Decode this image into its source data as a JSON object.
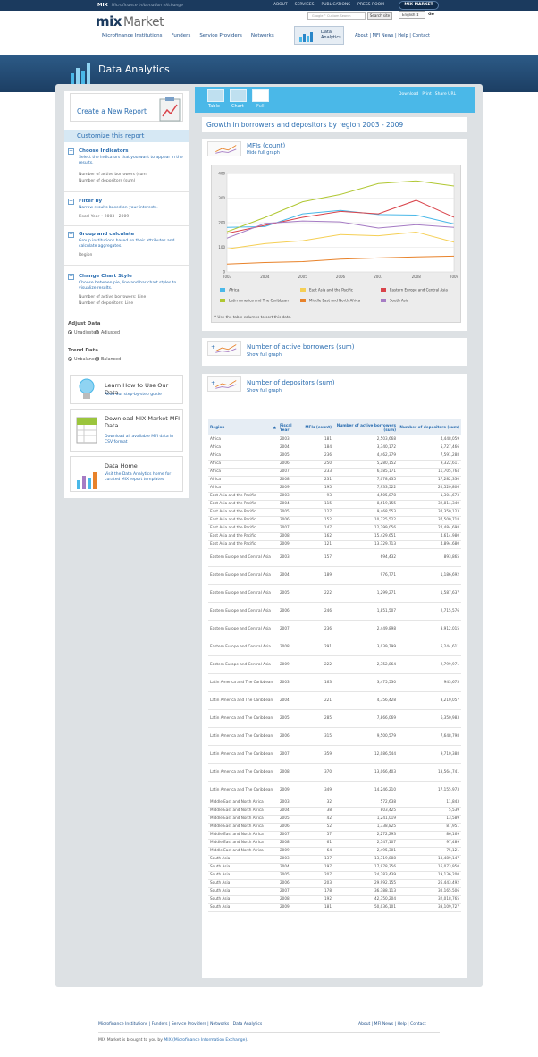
{
  "topbar": {
    "brand": "MIX",
    "tagline": "Microfinance Information eXchange",
    "links": [
      "ABOUT",
      "SERVICES",
      "PUBLICATIONS",
      "PRESS ROOM"
    ],
    "mix_market_btn": "MIX MARKET"
  },
  "header": {
    "logo_mark": "mix",
    "logo_word": "Market",
    "search_placeholder": "Google™ Custom Search",
    "search_btn": "Search site",
    "lang": "English",
    "go": "Go"
  },
  "mainnav": [
    "Microfinance Institutions",
    "Funders",
    "Service Providers",
    "Networks"
  ],
  "data_tab": {
    "line1": "Data",
    "line2": "Analytics"
  },
  "secnav": "About  |  MFI News  |  Help  |  Contact",
  "banner": {
    "title": "Data Analytics"
  },
  "left": {
    "create": "Create a New Report",
    "customize": "Customize this report",
    "indicators": {
      "h": "Choose Indicators",
      "d": "Select the indicators that you want to appear in the results.",
      "v1": "Number of active borrowers (sum)",
      "v2": "Number of depositors (sum)"
    },
    "filter": {
      "h": "Filter by",
      "d": "Narrow results based on your interests.",
      "v1": "Fiscal Year • 2003 - 2009"
    },
    "group": {
      "h": "Group and calculate",
      "d": "Group institutions based on their attributes and calculate aggregates.",
      "v1": "Region"
    },
    "style": {
      "h": "Change Chart Style",
      "d": "Choose between pie, line and bar chart styles to visualize results.",
      "v1": "Number of active borrowers: Line",
      "v2": "Number of depositors: Line"
    },
    "adjust": {
      "h": "Adjust Data",
      "o1": "Unadjusted",
      "o2": "Adjusted"
    },
    "trend": {
      "h": "Trend Data",
      "o1": "Unbalanced",
      "o2": "Balanced"
    },
    "card1": {
      "t": "Learn How to Use Our Data",
      "s": "Read our step-by-step guide"
    },
    "card2": {
      "t": "Download MIX Market MFI Data",
      "s": "Download all available MFI data in CSV format"
    },
    "card3": {
      "t": "Data Home",
      "s": "Visit the Data Analytics home for curated MIX report templates"
    }
  },
  "tabs": {
    "table": "Table",
    "chart": "Chart",
    "full": "Full"
  },
  "toplinks": [
    "Download",
    "Print",
    "Share URL"
  ],
  "report_title": "Growth in borrowers and depositors by region 2003 - 2009",
  "ind1": {
    "t": "MFIs (count)",
    "s": "Hide full graph"
  },
  "ind2": {
    "t": "Number of active borrowers (sum)",
    "s": "Show full graph"
  },
  "ind3": {
    "t": "Number of depositors (sum)",
    "s": "Show full graph"
  },
  "chart_note": "* Use the table columns to sort this data.",
  "chart_data": {
    "type": "line",
    "title": "MFIs (count)",
    "x": [
      2003,
      2004,
      2005,
      2006,
      2007,
      2008,
      2009
    ],
    "ylim": [
      0,
      400
    ],
    "yticks": [
      0,
      100,
      200,
      300,
      400
    ],
    "series": [
      {
        "name": "Africa",
        "color": "#4ab8e8",
        "values": [
          181,
          184,
          236,
          250,
          233,
          231,
          195
        ]
      },
      {
        "name": "East Asia and the Pacific",
        "color": "#f5cf55",
        "values": [
          93,
          115,
          127,
          152,
          147,
          162,
          121
        ]
      },
      {
        "name": "Eastern Europe and Central Asia",
        "color": "#d9434a",
        "values": [
          157,
          189,
          222,
          246,
          236,
          291,
          222
        ]
      },
      {
        "name": "Latin America and The Caribbean",
        "color": "#b0c732",
        "values": [
          163,
          221,
          285,
          315,
          359,
          370,
          349
        ]
      },
      {
        "name": "Middle East and North Africa",
        "color": "#e8822a",
        "values": [
          32,
          38,
          42,
          52,
          57,
          61,
          64
        ]
      },
      {
        "name": "South Asia",
        "color": "#a67cc4",
        "values": [
          137,
          197,
          207,
          203,
          178,
          192,
          181
        ]
      }
    ],
    "grid": true,
    "legend": "bottom"
  },
  "table": {
    "headers": [
      "Region",
      "Fiscal Year",
      "MFIs (count)",
      "Number of active borrowers (sum)",
      "Number of depositors (sum)"
    ],
    "rows": [
      [
        "Africa",
        "2003",
        "181",
        "2,503,668",
        "4,448,059"
      ],
      [
        "Africa",
        "2004",
        "184",
        "3,340,172",
        "5,727,466"
      ],
      [
        "Africa",
        "2005",
        "236",
        "4,462,379",
        "7,591,288"
      ],
      [
        "Africa",
        "2006",
        "250",
        "5,280,152",
        "9,322,611"
      ],
      [
        "Africa",
        "2007",
        "233",
        "6,185,171",
        "11,705,764"
      ],
      [
        "Africa",
        "2008",
        "231",
        "7,078,435",
        "17,282,330"
      ],
      [
        "Africa",
        "2009",
        "195",
        "7,933,522",
        "20,520,806"
      ],
      [
        "East Asia and the Pacific",
        "2003",
        "93",
        "4,505,878",
        "1,304,673"
      ],
      [
        "East Asia and the Pacific",
        "2004",
        "115",
        "8,619,155",
        "32,814,340"
      ],
      [
        "East Asia and the Pacific",
        "2005",
        "127",
        "9,468,553",
        "34,350,123"
      ],
      [
        "East Asia and the Pacific",
        "2006",
        "152",
        "10,725,522",
        "37,500,718"
      ],
      [
        "East Asia and the Pacific",
        "2007",
        "147",
        "12,299,056",
        "24,484,698"
      ],
      [
        "East Asia and the Pacific",
        "2008",
        "162",
        "15,429,651",
        "4,614,980"
      ],
      [
        "East Asia and the Pacific",
        "2009",
        "121",
        "13,729,713",
        "4,894,680"
      ],
      [
        "Eastern Europe and Central Asia",
        "2003",
        "157",
        "694,432",
        "893,865"
      ],
      [
        "Eastern Europe and Central Asia",
        "2004",
        "189",
        "976,771",
        "1,186,692"
      ],
      [
        "Eastern Europe and Central Asia",
        "2005",
        "222",
        "1,299,271",
        "1,587,637"
      ],
      [
        "Eastern Europe and Central Asia",
        "2006",
        "246",
        "1,851,507",
        "2,715,576"
      ],
      [
        "Eastern Europe and Central Asia",
        "2007",
        "236",
        "2,449,898",
        "3,912,015"
      ],
      [
        "Eastern Europe and Central Asia",
        "2008",
        "291",
        "3,039,799",
        "5,244,611"
      ],
      [
        "Eastern Europe and Central Asia",
        "2009",
        "222",
        "2,752,864",
        "2,799,971"
      ],
      [
        "Latin America and The Caribbean",
        "2003",
        "163",
        "3,475,530",
        "943,675"
      ],
      [
        "Latin America and The Caribbean",
        "2004",
        "221",
        "4,756,428",
        "3,210,057"
      ],
      [
        "Latin America and The Caribbean",
        "2005",
        "285",
        "7,866,069",
        "6,350,983"
      ],
      [
        "Latin America and The Caribbean",
        "2006",
        "315",
        "9,500,579",
        "7,648,798"
      ],
      [
        "Latin America and The Caribbean",
        "2007",
        "359",
        "12,086,544",
        "9,710,388"
      ],
      [
        "Latin America and The Caribbean",
        "2008",
        "370",
        "13,066,403",
        "13,564,741"
      ],
      [
        "Latin America and The Caribbean",
        "2009",
        "349",
        "14,246,210",
        "17,155,973"
      ],
      [
        "Middle East and North Africa",
        "2003",
        "32",
        "572,638",
        "11,843"
      ],
      [
        "Middle East and North Africa",
        "2004",
        "38",
        "803,425",
        "5,539"
      ],
      [
        "Middle East and North Africa",
        "2005",
        "42",
        "1,241,019",
        "13,589"
      ],
      [
        "Middle East and North Africa",
        "2006",
        "52",
        "1,738,825",
        "87,951"
      ],
      [
        "Middle East and North Africa",
        "2007",
        "57",
        "2,272,293",
        "86,169"
      ],
      [
        "Middle East and North Africa",
        "2008",
        "61",
        "2,547,107",
        "97,489"
      ],
      [
        "Middle East and North Africa",
        "2009",
        "64",
        "2,495,301",
        "75,121"
      ],
      [
        "South Asia",
        "2003",
        "137",
        "13,719,888",
        "13,489,147"
      ],
      [
        "South Asia",
        "2004",
        "197",
        "17,978,356",
        "16,073,950"
      ],
      [
        "South Asia",
        "2005",
        "207",
        "24,383,439",
        "19,136,200"
      ],
      [
        "South Asia",
        "2006",
        "203",
        "29,992,155",
        "26,443,492"
      ],
      [
        "South Asia",
        "2007",
        "178",
        "36,388,113",
        "30,165,506"
      ],
      [
        "South Asia",
        "2008",
        "192",
        "42,350,204",
        "32,018,765"
      ],
      [
        "South Asia",
        "2009",
        "181",
        "50,036,101",
        "33,109,727"
      ]
    ]
  },
  "footer": {
    "links": "Microfinance Institutions  |  Funders  |  Service Providers  |  Networks  |  Data Analytics",
    "links_right": "About  |  MFI News  |  Help  |  Contact",
    "note_pre": "MIX Market is brought to you by ",
    "note_link": "MIX (Microfinance Information Exchange)",
    "note_post": "."
  }
}
